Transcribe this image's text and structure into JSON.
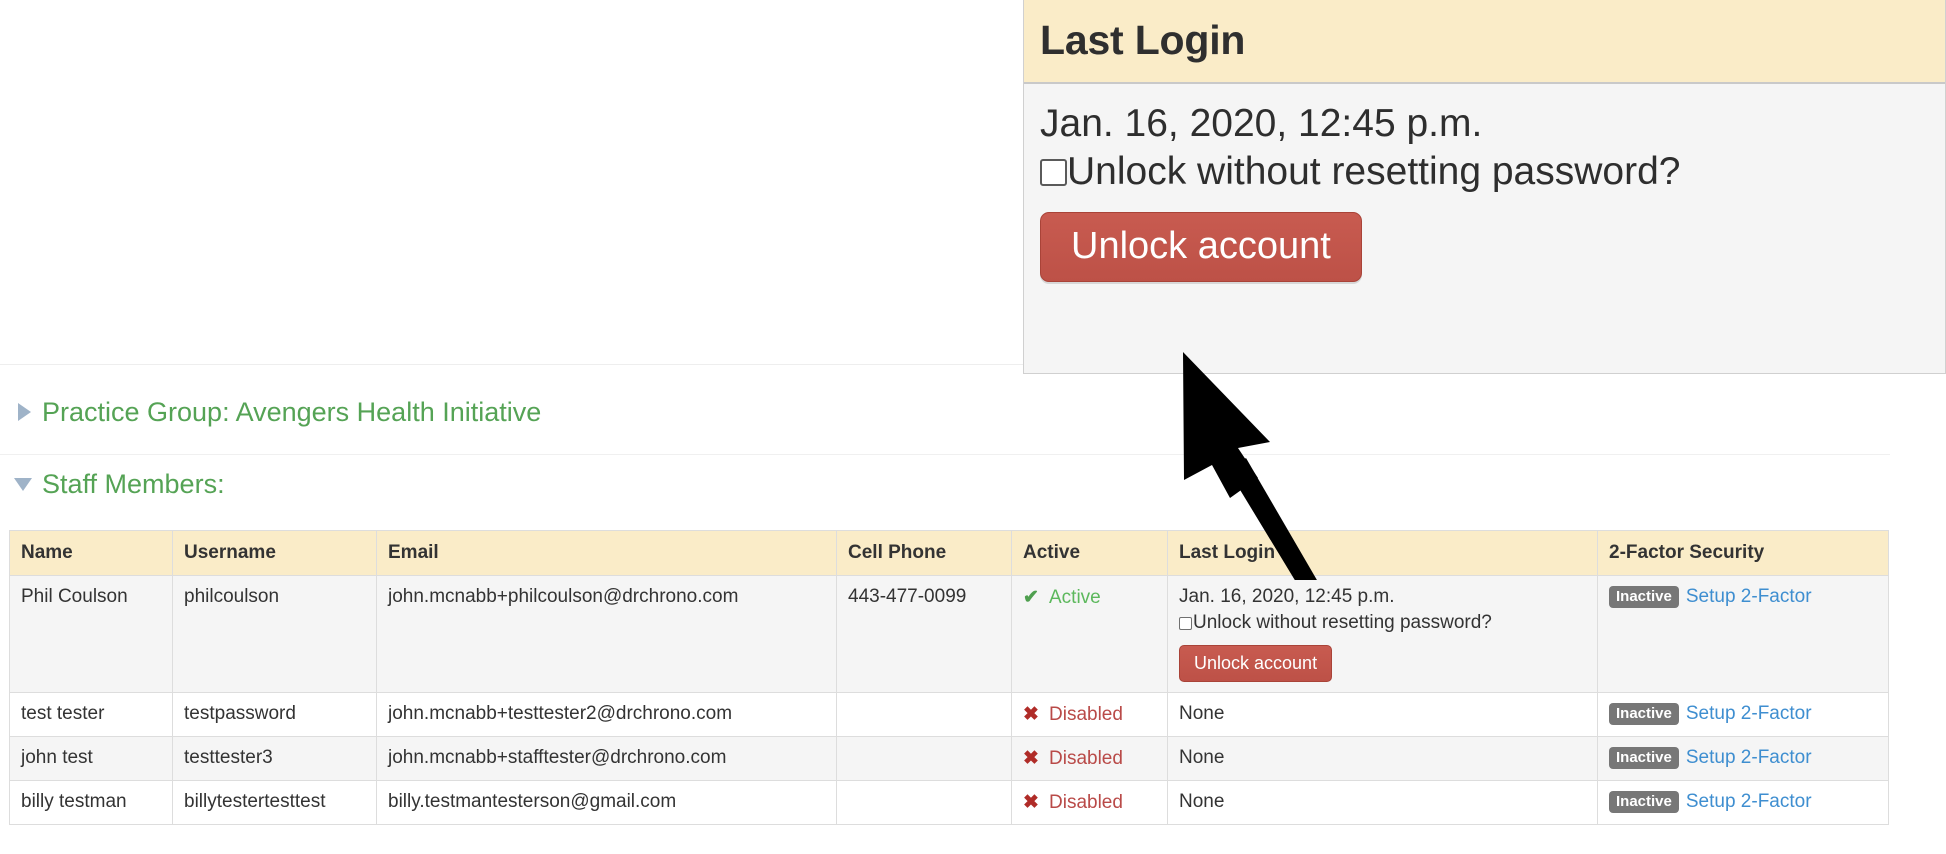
{
  "zoom_panel": {
    "header_title": "Last Login",
    "last_login_date": "Jan. 16, 2020, 12:45 p.m.",
    "checkbox_label": "Unlock without resetting password?",
    "unlock_button_label": "Unlock account",
    "checked": false
  },
  "sections": [
    {
      "id": "practice-group",
      "label": "Practice Group: Avengers Health Initiative",
      "expanded": false,
      "arrow_icon": "triangle-right-icon"
    },
    {
      "id": "staff-members",
      "label": "Staff Members:",
      "expanded": true,
      "arrow_icon": "triangle-down-icon"
    }
  ],
  "staff_table": {
    "columns": [
      "Name",
      "Username",
      "Email",
      "Cell Phone",
      "Active",
      "Last Login",
      "2-Factor Security"
    ],
    "rows": [
      {
        "name": "Phil Coulson",
        "username": "philcoulson",
        "email": "john.mcnabb+philcoulson@drchrono.com",
        "cell_phone": "443-477-0099",
        "active_label": "Active",
        "active_icon": "check-icon",
        "active_state": "active",
        "last_login": "Jan. 16, 2020, 12:45 p.m.",
        "has_unlock": true,
        "unlock_checkbox_label": "Unlock without resetting password?",
        "unlock_button_label": "Unlock account",
        "twofactor_badge": "Inactive",
        "twofactor_link": "Setup 2-Factor"
      },
      {
        "name": "test tester",
        "username": "testpassword",
        "email": "john.mcnabb+testtester2@drchrono.com",
        "cell_phone": "",
        "active_label": "Disabled",
        "active_icon": "x-icon",
        "active_state": "disabled",
        "last_login": "None",
        "has_unlock": false,
        "twofactor_badge": "Inactive",
        "twofactor_link": "Setup 2-Factor"
      },
      {
        "name": "john test",
        "username": "testtester3",
        "email": "john.mcnabb+stafftester@drchrono.com",
        "cell_phone": "",
        "active_label": "Disabled",
        "active_icon": "x-icon",
        "active_state": "disabled",
        "last_login": "None",
        "has_unlock": false,
        "twofactor_badge": "Inactive",
        "twofactor_link": "Setup 2-Factor"
      },
      {
        "name": "billy testman",
        "username": "billytestertesttest",
        "email": "billy.testmantesterson@gmail.com",
        "cell_phone": "",
        "active_label": "Disabled",
        "active_icon": "x-icon",
        "active_state": "disabled",
        "last_login": "None",
        "has_unlock": false,
        "twofactor_badge": "Inactive",
        "twofactor_link": "Setup 2-Factor"
      }
    ]
  },
  "colors": {
    "header_bg": "#faecc8",
    "danger_button": "#c4564c",
    "active_green": "#5cb85c",
    "disabled_red": "#b94a48",
    "link_blue": "#3e8ed0",
    "badge_gray": "#777777",
    "section_green": "#55a355",
    "triangle_blue_gray": "#9fb3c8"
  }
}
